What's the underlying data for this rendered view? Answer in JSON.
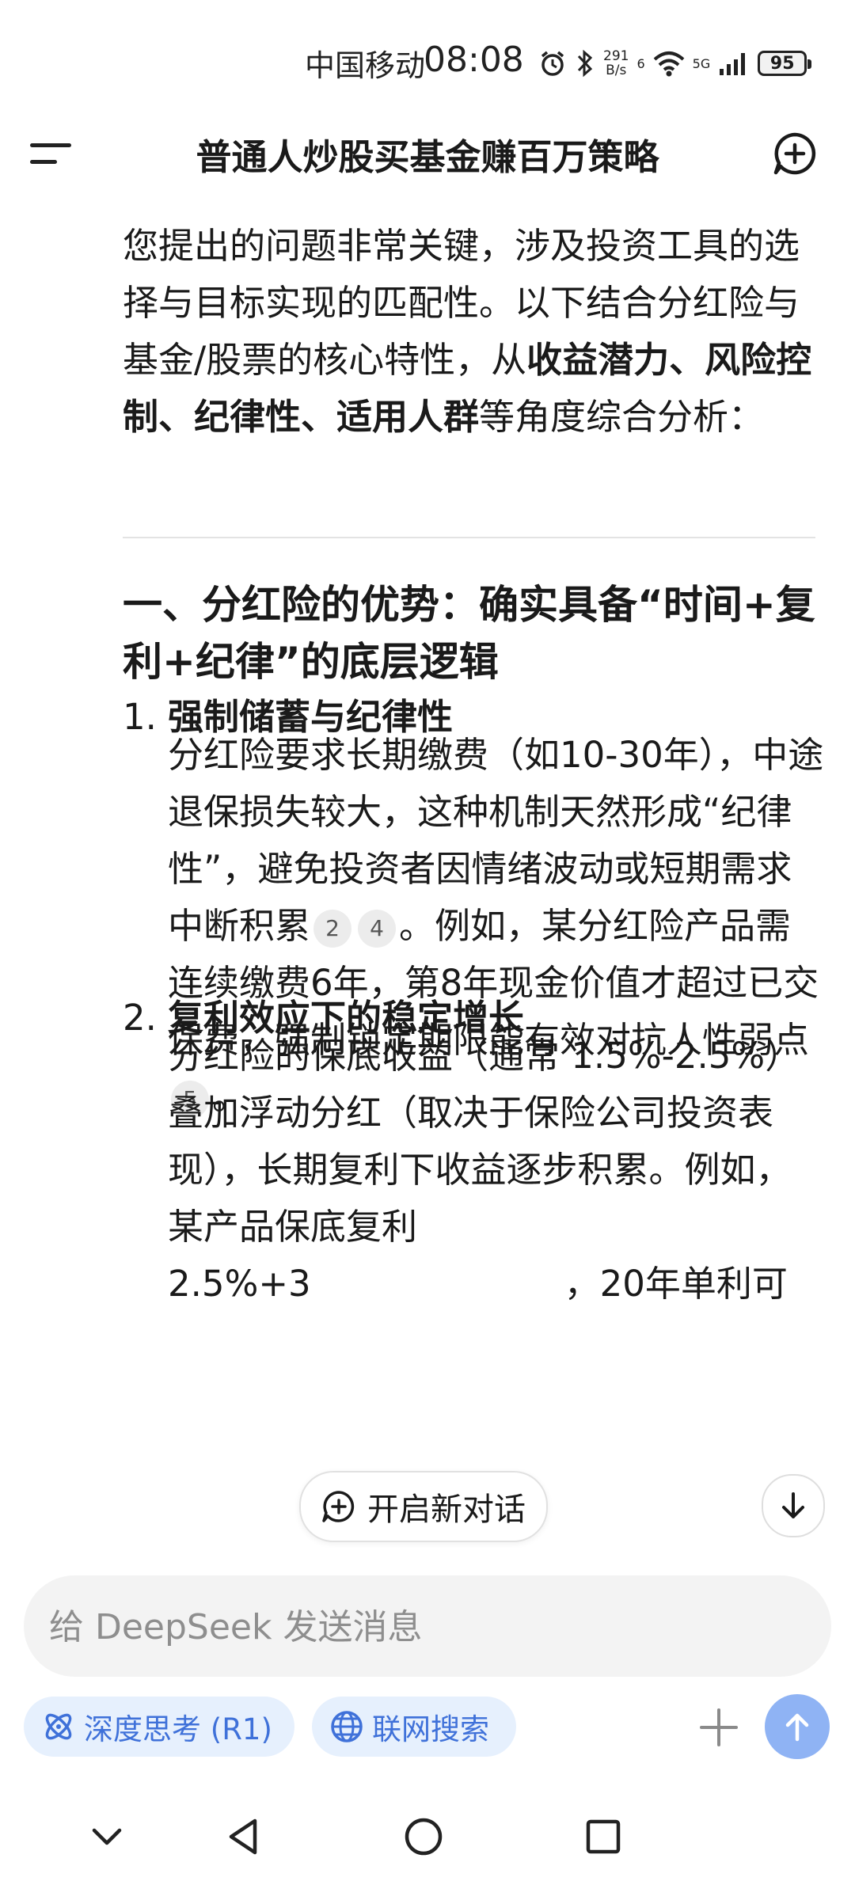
{
  "status_bar": {
    "carrier": "中国移动",
    "time": "08:08",
    "net_speed_value": "291",
    "net_speed_unit": "B/s",
    "wifi_badge": "6",
    "signal_badge": "5G",
    "battery": "95",
    "icons": [
      "alarm-icon",
      "bluetooth-icon",
      "wifi-icon",
      "signal-icon",
      "battery-icon"
    ]
  },
  "header": {
    "title": "普通人炒股买基金赚百万策略",
    "icons": [
      "menu-icon",
      "new-chat-icon"
    ]
  },
  "message": {
    "intro_pre": "您提出的问题非常关键，涉及投资工具的选择与目标实现的匹配性。以下结合分红险与基金/股票的核心特性，从",
    "intro_bold": "收益潜力、风险控制、纪律性、适用人群",
    "intro_post": "等角度综合分析：",
    "section_title": "一、分红险的优势：确实具备“时间+复利+纪律”的底层逻辑",
    "items": [
      {
        "num": "1.",
        "title": "强制储蓄与纪律性",
        "body_a": "分红险要求长期缴费（如10-30年），中途退保损失较大，这种机制天然形成“纪律性”，避免投资者因情绪波动或短期需求中断积累",
        "cite_1": "2",
        "cite_2": "4",
        "body_b": "。例如，某分红险产品需连续缴费6年，第8年现金价值才超过已交保费，强制锁定期限能有效对抗人性弱点",
        "cite_3": "5",
        "body_c": "。"
      },
      {
        "num": "2.",
        "title": "复利效应下的稳定增长",
        "body_a": "分红险的保底收益（通常 1.5%-2.5%）叠加浮动分红（取决于保险公司投资表现），长期复利下收益逐步积累。例如，某产品保底复利 2.5%+3",
        "body_b": "，20年单利可"
      }
    ]
  },
  "floating": {
    "new_chat_label": "开启新对话"
  },
  "composer": {
    "placeholder": "给 DeepSeek 发送消息",
    "value": "",
    "deep_think_label": "深度思考 (R1)",
    "web_search_label": "联网搜索"
  },
  "nav_bar": {
    "icons": [
      "chevron-down-icon",
      "back-icon",
      "home-icon",
      "recents-icon"
    ]
  },
  "colors": {
    "accent": "#3f71d9",
    "chip_bg": "#e6f0fd",
    "send_bg": "#8fb3f4",
    "input_bg": "#f3f3f3"
  }
}
